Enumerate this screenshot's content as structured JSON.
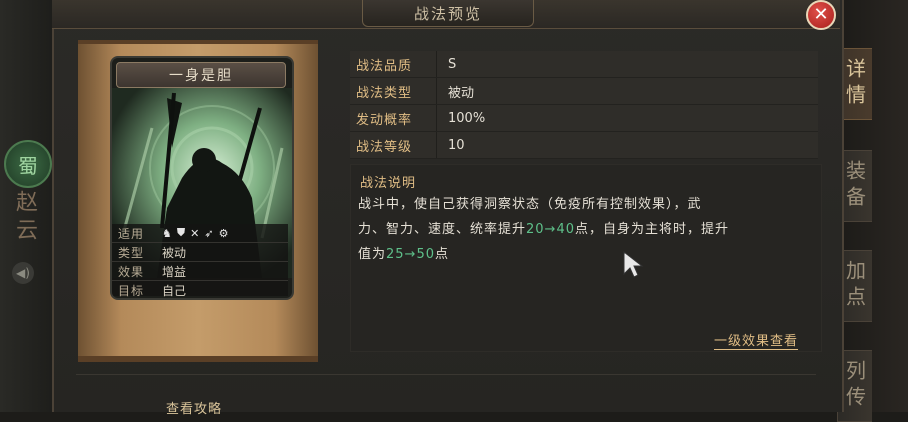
{
  "window": {
    "title": "战法预览",
    "close_icon": "close-icon"
  },
  "side_tabs": [
    "详情",
    "装备",
    "加点",
    "列传"
  ],
  "character": {
    "faction": "蜀",
    "name": "赵云"
  },
  "card": {
    "name": "一身是胆",
    "info": [
      {
        "key": "适用",
        "icons": [
          "cavalry-icon",
          "shield-icon",
          "archer-icon",
          "spear-icon",
          "siege-icon"
        ]
      },
      {
        "key": "类型",
        "value": "被动"
      },
      {
        "key": "效果",
        "value": "增益"
      },
      {
        "key": "目标",
        "value": "自己"
      }
    ]
  },
  "attributes": [
    {
      "key": "战法品质",
      "value": "S"
    },
    {
      "key": "战法类型",
      "value": "被动"
    },
    {
      "key": "发动概率",
      "value": "100%"
    },
    {
      "key": "战法等级",
      "value": "10"
    }
  ],
  "description": {
    "label": "战法说明",
    "line1": "战斗中，使自己获得洞察状态（免疫所有控制效果），武",
    "line2a": "力、智力、速度、统率提升",
    "line2hl": "20→40",
    "line2b": "点，自身为主将时，提升",
    "line3a": "值为",
    "line3hl": "25→50",
    "line3b": "点"
  },
  "link": "一级效果查看",
  "guide": "查看攻略",
  "colors": {
    "accent_gold": "#e0bd85",
    "highlight_green": "#5ec08a",
    "close_red": "#c52e28"
  }
}
